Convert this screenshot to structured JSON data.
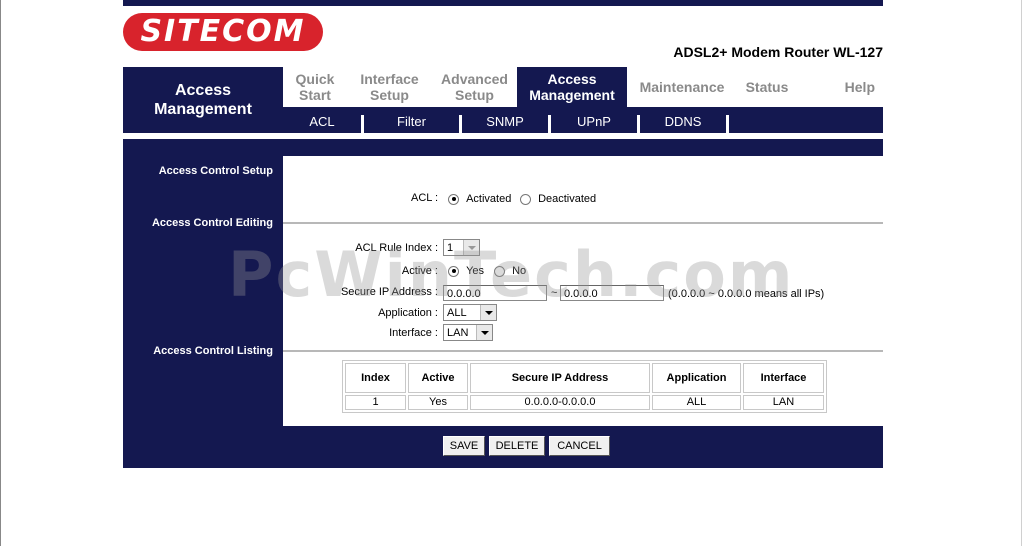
{
  "brand": {
    "logo_text": "SITECOM",
    "model": "ADSL2+ Modem Router WL-127"
  },
  "section_title": "Access Management",
  "tabs": [
    {
      "label": "Quick Start"
    },
    {
      "label": "Interface Setup"
    },
    {
      "label": "Advanced Setup"
    },
    {
      "label": "Access Management"
    },
    {
      "label": "Maintenance"
    },
    {
      "label": "Status"
    },
    {
      "label": "Help"
    }
  ],
  "subnav": [
    "ACL",
    "Filter",
    "SNMP",
    "UPnP",
    "DDNS"
  ],
  "sidebar": {
    "setup": "Access Control Setup",
    "editing": "Access Control Editing",
    "listing": "Access Control Listing"
  },
  "acl": {
    "label": "ACL :",
    "activated": "Activated",
    "deactivated": "Deactivated",
    "selected": "Activated"
  },
  "editing": {
    "rule_index_label": "ACL Rule Index :",
    "rule_index_value": "1",
    "active_label": "Active :",
    "yes": "Yes",
    "no": "No",
    "ip_label": "Secure IP Address :",
    "ip_start": "0.0.0.0",
    "ip_sep": "~",
    "ip_end": "0.0.0.0",
    "ip_hint": "(0.0.0.0 ~ 0.0.0.0 means all IPs)",
    "app_label": "Application :",
    "app_value": "ALL",
    "iface_label": "Interface :",
    "iface_value": "LAN"
  },
  "table": {
    "headers": [
      "Index",
      "Active",
      "Secure IP Address",
      "Application",
      "Interface"
    ],
    "rows": [
      [
        "1",
        "Yes",
        "0.0.0.0-0.0.0.0",
        "ALL",
        "LAN"
      ]
    ]
  },
  "buttons": {
    "save": "SAVE",
    "delete": "DELETE",
    "cancel": "CANCEL"
  },
  "watermark": "PcWinTech.com",
  "colors": {
    "navy": "#141850",
    "brand_red": "#d8232c"
  }
}
